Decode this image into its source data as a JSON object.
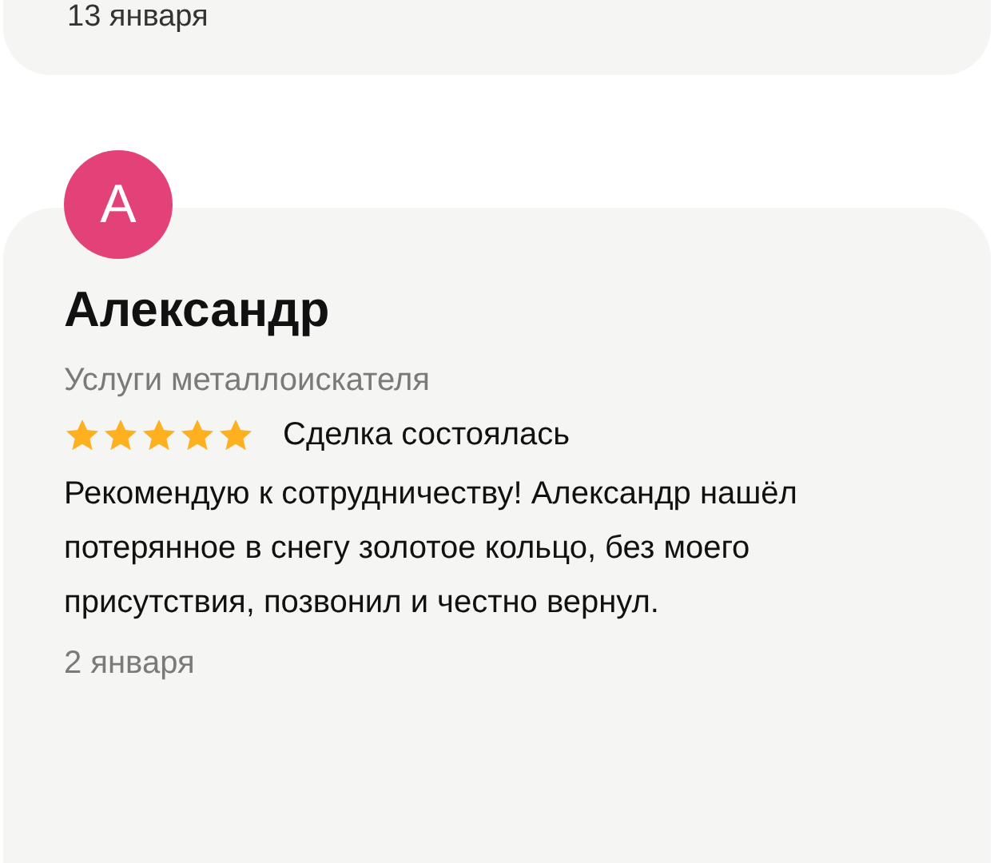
{
  "previous_review": {
    "date": "13 января"
  },
  "review": {
    "avatar_letter": "А",
    "author": "Александр",
    "service": "Услуги металлоискателя",
    "stars": 5,
    "deal_status": "Сделка состоялась",
    "text": "Рекомендую к сотрудничеству! Александр нашёл потерянное в снегу золотое кольцо, без моего присутствия, позвонил и честно вернул.",
    "date": "2 января"
  }
}
